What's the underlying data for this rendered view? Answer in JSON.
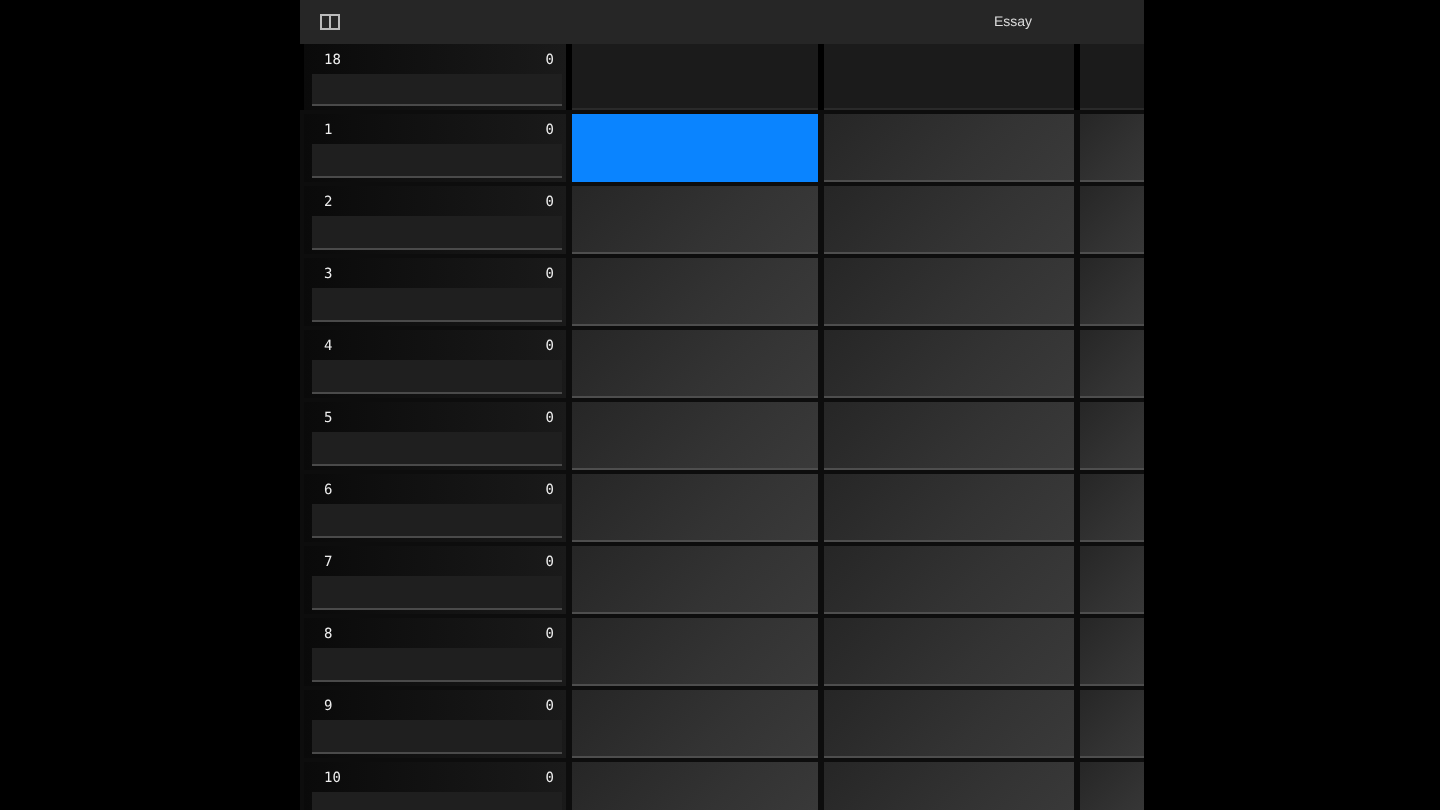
{
  "toolbar": {
    "title": "Essay"
  },
  "header_row": {
    "label": "18",
    "count": "0",
    "cells": [
      {
        "selected": false
      },
      {
        "selected": false
      },
      {
        "selected": false
      }
    ]
  },
  "rows": [
    {
      "label": "1",
      "count": "0",
      "cells": [
        {
          "selected": true
        },
        {
          "selected": false
        },
        {
          "selected": false
        }
      ]
    },
    {
      "label": "2",
      "count": "0",
      "cells": [
        {
          "selected": false
        },
        {
          "selected": false
        },
        {
          "selected": false
        }
      ]
    },
    {
      "label": "3",
      "count": "0",
      "cells": [
        {
          "selected": false
        },
        {
          "selected": false
        },
        {
          "selected": false
        }
      ]
    },
    {
      "label": "4",
      "count": "0",
      "cells": [
        {
          "selected": false
        },
        {
          "selected": false
        },
        {
          "selected": false
        }
      ]
    },
    {
      "label": "5",
      "count": "0",
      "cells": [
        {
          "selected": false
        },
        {
          "selected": false
        },
        {
          "selected": false
        }
      ]
    },
    {
      "label": "6",
      "count": "0",
      "cells": [
        {
          "selected": false
        },
        {
          "selected": false
        },
        {
          "selected": false
        }
      ]
    },
    {
      "label": "7",
      "count": "0",
      "cells": [
        {
          "selected": false
        },
        {
          "selected": false
        },
        {
          "selected": false
        }
      ]
    },
    {
      "label": "8",
      "count": "0",
      "cells": [
        {
          "selected": false
        },
        {
          "selected": false
        },
        {
          "selected": false
        }
      ]
    },
    {
      "label": "9",
      "count": "0",
      "cells": [
        {
          "selected": false
        },
        {
          "selected": false
        },
        {
          "selected": false
        }
      ]
    },
    {
      "label": "10",
      "count": "0",
      "cells": [
        {
          "selected": false
        },
        {
          "selected": false
        },
        {
          "selected": false
        }
      ]
    }
  ]
}
